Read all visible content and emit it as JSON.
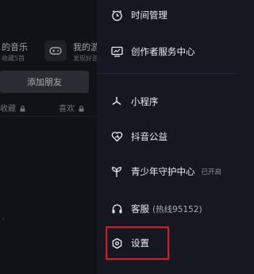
{
  "profile": {
    "music_title": "的音乐",
    "music_sub": "收藏5首",
    "game_title": "我的游",
    "game_sub": "发现好游",
    "add_friend": "添加朋友",
    "tab_favorites": "收藏",
    "tab_likes": "喜欢",
    "stray_text": ","
  },
  "menu": {
    "time_management": "时间管理",
    "creator_center": "创作者服务中心",
    "mini_programs": "小程序",
    "public_welfare": "抖音公益",
    "youth_guardian": "青少年守护中心",
    "youth_guardian_status": "已开启",
    "customer_service": "客服",
    "customer_service_hotline": "(热线95152)",
    "settings": "设置"
  },
  "colors": {
    "drawer_bg": "#151821",
    "text": "#ececf0",
    "highlight": "#e0141e"
  },
  "icons": {
    "time_management": "clock-icon",
    "creator_center": "monitor-icon",
    "mini_programs": "asterisk-icon",
    "public_welfare": "heart-icon",
    "youth_guardian": "sprout-icon",
    "customer_service": "headset-icon",
    "settings": "gear-icon",
    "game": "gamepad-icon",
    "lock": "lock-icon"
  }
}
